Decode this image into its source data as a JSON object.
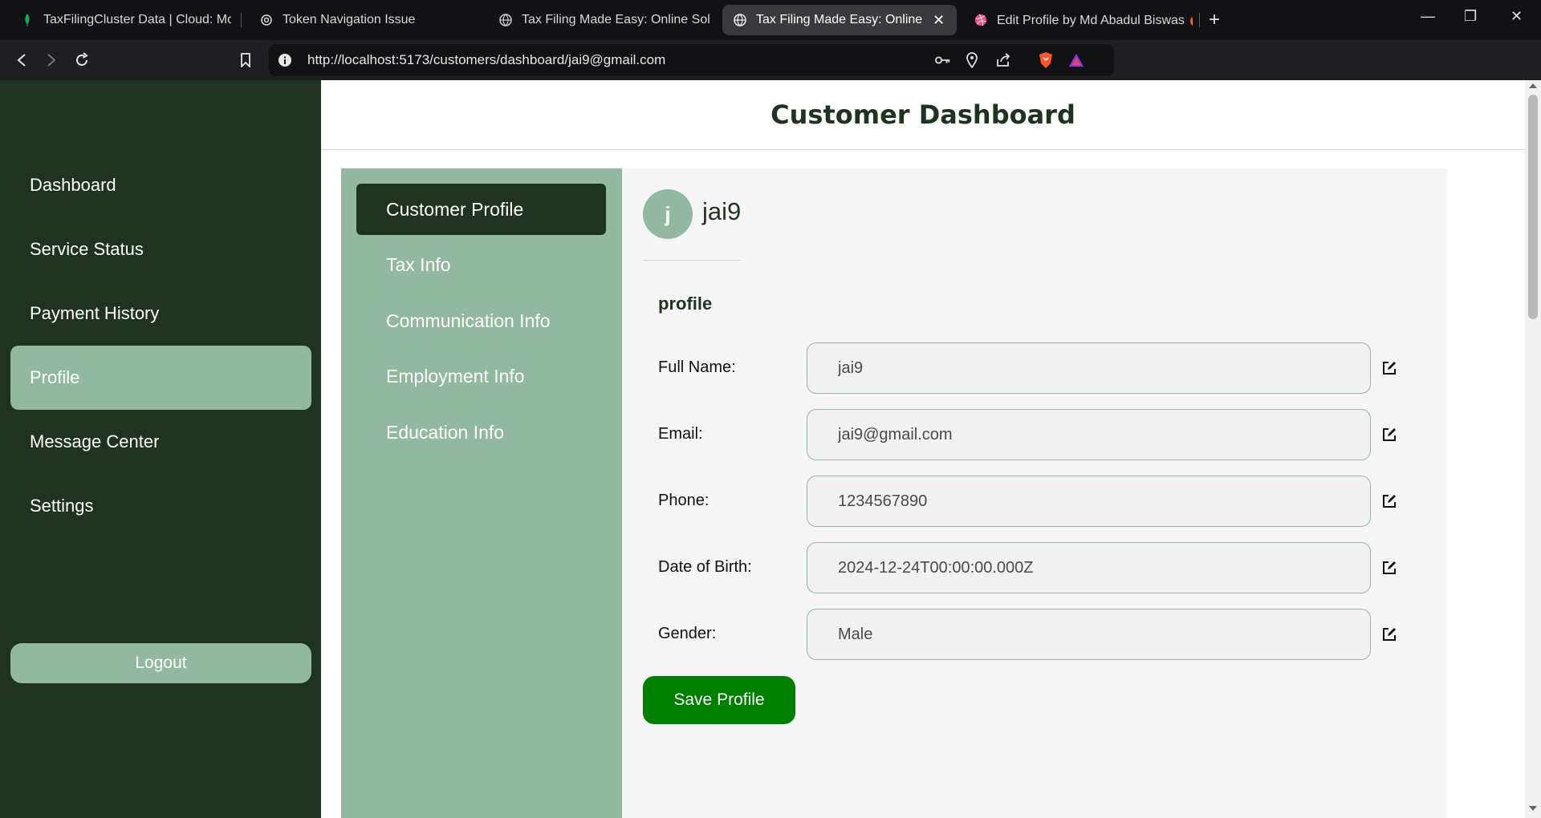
{
  "browser": {
    "tabs": [
      {
        "title": "TaxFilingCluster Data | Cloud: Mong",
        "icon": "mongodb-leaf-icon"
      },
      {
        "title": "Token Navigation Issue",
        "icon": "openai-icon"
      },
      {
        "title": "Tax Filing Made Easy: Online Solutio",
        "icon": "globe-icon"
      },
      {
        "title": "Tax Filing Made Easy: Online So",
        "icon": "globe-icon",
        "active": true
      },
      {
        "title": "Edit Profile by Md Abadul Biswas 🔥",
        "icon": "dribbble-icon"
      }
    ],
    "url": "http://localhost:5173/customers/dashboard/jai9@gmail.com"
  },
  "sidebar": {
    "items": [
      {
        "label": "Dashboard"
      },
      {
        "label": "Service Status"
      },
      {
        "label": "Payment History"
      },
      {
        "label": "Profile",
        "active": true
      },
      {
        "label": "Message Center"
      },
      {
        "label": "Settings"
      }
    ],
    "logout_label": "Logout"
  },
  "header": {
    "title": "Customer Dashboard"
  },
  "subnav": {
    "items": [
      {
        "label": "Customer Profile",
        "active": true
      },
      {
        "label": "Tax Info"
      },
      {
        "label": "Communication Info"
      },
      {
        "label": "Employment Info"
      },
      {
        "label": "Education Info"
      }
    ]
  },
  "profile": {
    "avatar_letter": "j",
    "username": "jai9",
    "section_title": "profile",
    "fields": [
      {
        "label": "Full Name:",
        "value": "jai9"
      },
      {
        "label": "Email:",
        "value": "jai9@gmail.com"
      },
      {
        "label": "Phone:",
        "value": "1234567890"
      },
      {
        "label": "Date of Birth:",
        "value": "2024-12-24T00:00:00.000Z"
      },
      {
        "label": "Gender:",
        "value": "Male"
      }
    ],
    "save_label": "Save Profile"
  },
  "colors": {
    "sidebar_bg": "#1e3320",
    "accent_light": "#93b8a1",
    "save_button": "#008000"
  }
}
